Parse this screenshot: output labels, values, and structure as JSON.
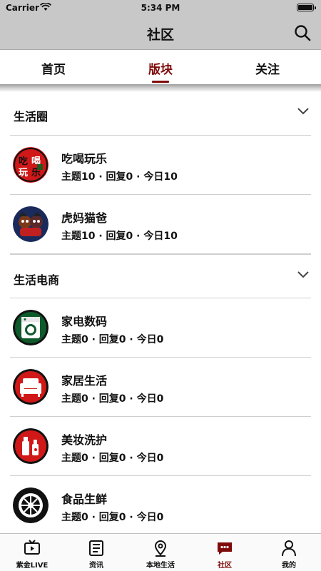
{
  "status_bar": {
    "carrier": "Carrier",
    "time": "5:34 PM"
  },
  "nav": {
    "title": "社区"
  },
  "tabs": [
    {
      "label": "首页",
      "active": false
    },
    {
      "label": "版块",
      "active": true
    },
    {
      "label": "关注",
      "active": false
    }
  ],
  "sections": [
    {
      "title": "生活圈",
      "items": [
        {
          "name": "吃喝玩乐",
          "stats": "主题10 · 回复0 · 今日10",
          "icon": "food-fun-icon"
        },
        {
          "name": "虎妈猫爸",
          "stats": "主题10 · 回复0 · 今日10",
          "icon": "parents-icon"
        }
      ]
    },
    {
      "title": "生活电商",
      "items": [
        {
          "name": "家电数码",
          "stats": "主题0 · 回复0 · 今日0",
          "icon": "washing-machine-icon"
        },
        {
          "name": "家居生活",
          "stats": "主题0 · 回复0 · 今日0",
          "icon": "sofa-icon"
        },
        {
          "name": "美妆洗护",
          "stats": "主题0 · 回复0 · 今日0",
          "icon": "cosmetics-icon"
        },
        {
          "name": "食品生鲜",
          "stats": "主题0 · 回复0 · 今日0",
          "icon": "tire-icon"
        }
      ]
    }
  ],
  "tab_bar": [
    {
      "label": "紫金LIVE",
      "icon": "tv-icon",
      "active": false
    },
    {
      "label": "资讯",
      "icon": "news-icon",
      "active": false
    },
    {
      "label": "本地生活",
      "icon": "location-icon",
      "active": false
    },
    {
      "label": "社区",
      "icon": "chat-icon",
      "active": true
    },
    {
      "label": "我的",
      "icon": "person-icon",
      "active": false
    }
  ],
  "colors": {
    "accent": "#7f0a0a",
    "bar_bg": "#c8c8c8",
    "avatar_red": "#d01818",
    "avatar_navy": "#1a2a5a",
    "avatar_green": "#0e5a2a"
  }
}
